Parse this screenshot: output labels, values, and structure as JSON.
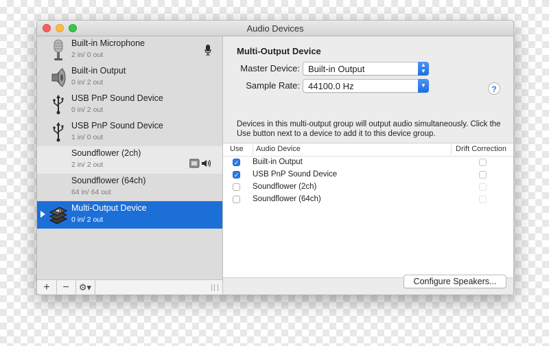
{
  "window": {
    "title": "Audio Devices"
  },
  "sidebar": {
    "devices": [
      {
        "name": "Built-in Microphone",
        "io": "2 in/ 0 out",
        "icon": "microphone-icon",
        "status_icon": "microphone-small-icon"
      },
      {
        "name": "Built-in Output",
        "io": "0 in/ 2 out",
        "icon": "speaker-icon"
      },
      {
        "name": "USB PnP Sound Device",
        "io": "0 in/ 2 out",
        "icon": "usb-icon"
      },
      {
        "name": "USB PnP Sound Device",
        "io": "1 in/ 0 out",
        "icon": "usb-icon"
      },
      {
        "name": "Soundflower (2ch)",
        "io": "2 in/ 2 out",
        "status_icons": [
          "system-alert-icon",
          "volume-icon"
        ]
      },
      {
        "name": "Soundflower (64ch)",
        "io": "64 in/ 64 out"
      },
      {
        "name": "Multi-Output Device",
        "io": "0 in/ 2 out",
        "icon": "multi-output-icon",
        "selected": true
      }
    ],
    "toolbar": {
      "add": "+",
      "remove": "−",
      "gear": "⚙▾"
    }
  },
  "main": {
    "title": "Multi-Output Device",
    "master_label": "Master Device:",
    "master_value": "Built-in Output",
    "rate_label": "Sample Rate:",
    "rate_value": "44100.0 Hz",
    "help": "?",
    "description": "Devices in this multi-output group will output audio simultaneously. Click the Use button next to a device to add it to this device group.",
    "table": {
      "headers": {
        "use": "Use",
        "device": "Audio Device",
        "drift": "Drift Correction"
      },
      "rows": [
        {
          "device": "Built-in Output",
          "use": true,
          "drift": false
        },
        {
          "device": "USB PnP Sound Device",
          "use": true,
          "drift": false
        },
        {
          "device": "Soundflower (2ch)",
          "use": false,
          "drift": false
        },
        {
          "device": "Soundflower (64ch)",
          "use": false,
          "drift": false
        }
      ]
    },
    "configure_button": "Configure Speakers..."
  },
  "colors": {
    "selection": "#1d6fd8",
    "checkbox_on": "#2a7ae2",
    "close": "#fc605c",
    "minimize": "#fdbc40",
    "zoom": "#34c84a"
  }
}
